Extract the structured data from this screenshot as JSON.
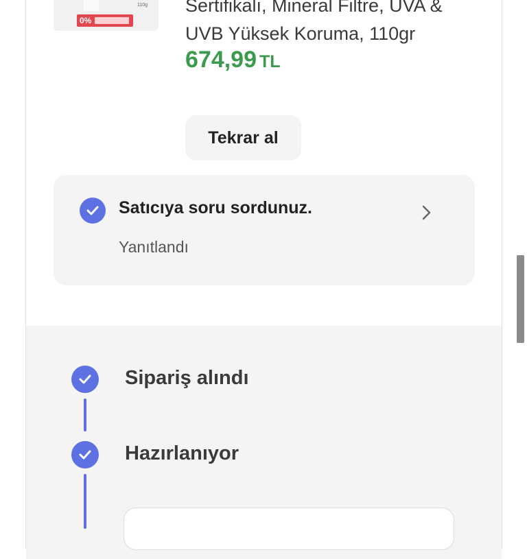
{
  "product": {
    "title_line1": "Sertifikalı, Mineral Filtre, UVA &",
    "title_line2": "UVB Yüksek Koruma, 110gr",
    "price": "674,99",
    "currency": "TL",
    "image": {
      "badge": "0%",
      "size_label": "110g"
    }
  },
  "actions": {
    "rebuy_label": "Tekrar al"
  },
  "question": {
    "title": "Satıcıya soru sordunuz.",
    "status": "Yanıtlandı"
  },
  "tracking": {
    "steps": [
      {
        "label": "Sipariş alındı",
        "done": true
      },
      {
        "label": "Hazırlanıyor",
        "done": true
      }
    ]
  },
  "colors": {
    "price": "#3b9a4d",
    "accent": "#5e71e2",
    "badge": "#e2474f"
  },
  "icons": [
    "check-circle-icon",
    "chevron-right-icon"
  ]
}
